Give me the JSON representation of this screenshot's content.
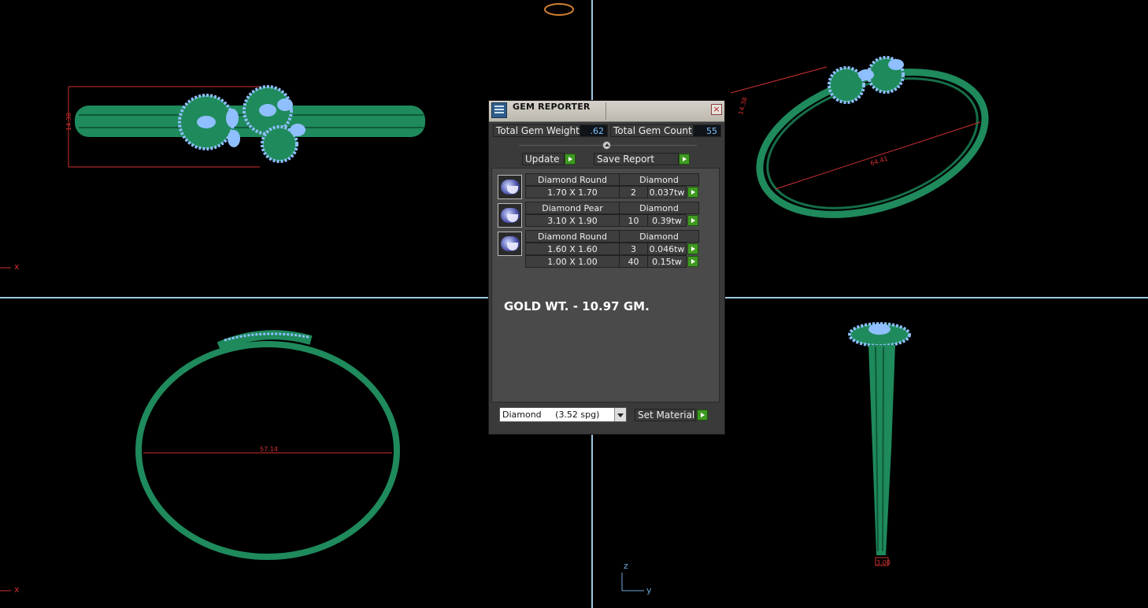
{
  "dialog": {
    "title": "GEM REPORTER",
    "close_glyph": "×",
    "total_gem_weight_label": "Total Gem Weight",
    "total_gem_weight_value": ".62",
    "total_gem_count_label": "Total Gem Count",
    "total_gem_count_value": "55",
    "update_label": "Update",
    "save_report_label": "Save Report",
    "gem_groups": [
      {
        "icon": "diamond-round-icon",
        "shape": "Diamond Round",
        "material": "Diamond",
        "rows": [
          {
            "size": "1.70 X 1.70",
            "count": "2",
            "weight": "0.037tw"
          }
        ]
      },
      {
        "icon": "diamond-pear-icon",
        "shape": "Diamond Pear",
        "material": "Diamond",
        "rows": [
          {
            "size": "3.10 X 1.90",
            "count": "10",
            "weight": "0.39tw"
          }
        ]
      },
      {
        "icon": "diamond-round-icon",
        "shape": "Diamond Round",
        "material": "Diamond",
        "rows": [
          {
            "size": "1.60 X 1.60",
            "count": "3",
            "weight": "0.046tw"
          },
          {
            "size": "1.00 X 1.00",
            "count": "40",
            "weight": "0.15tw"
          }
        ]
      }
    ],
    "gold_weight_text": "GOLD WT. - 10.97 GM.",
    "material_select_value": "Diamond     (3.52 spg)",
    "set_material_label": "Set Material"
  },
  "viewports": {
    "top_left": {
      "dimension": "14.38",
      "axis": "x"
    },
    "top_right": {
      "dimension_a": "14.38",
      "dimension_b": "64.41"
    },
    "bottom_left": {
      "dimension": "57.14",
      "axis": "x"
    },
    "bottom_right": {
      "dimension": "3.00",
      "axis_vertical": "z",
      "axis_horizontal": "y"
    }
  },
  "colors": {
    "background": "#000000",
    "viewport_divider": "#9fc7e0",
    "metal": "#1f8a5c",
    "gem": "#8fbfff",
    "dimension_line": "#d03030"
  }
}
